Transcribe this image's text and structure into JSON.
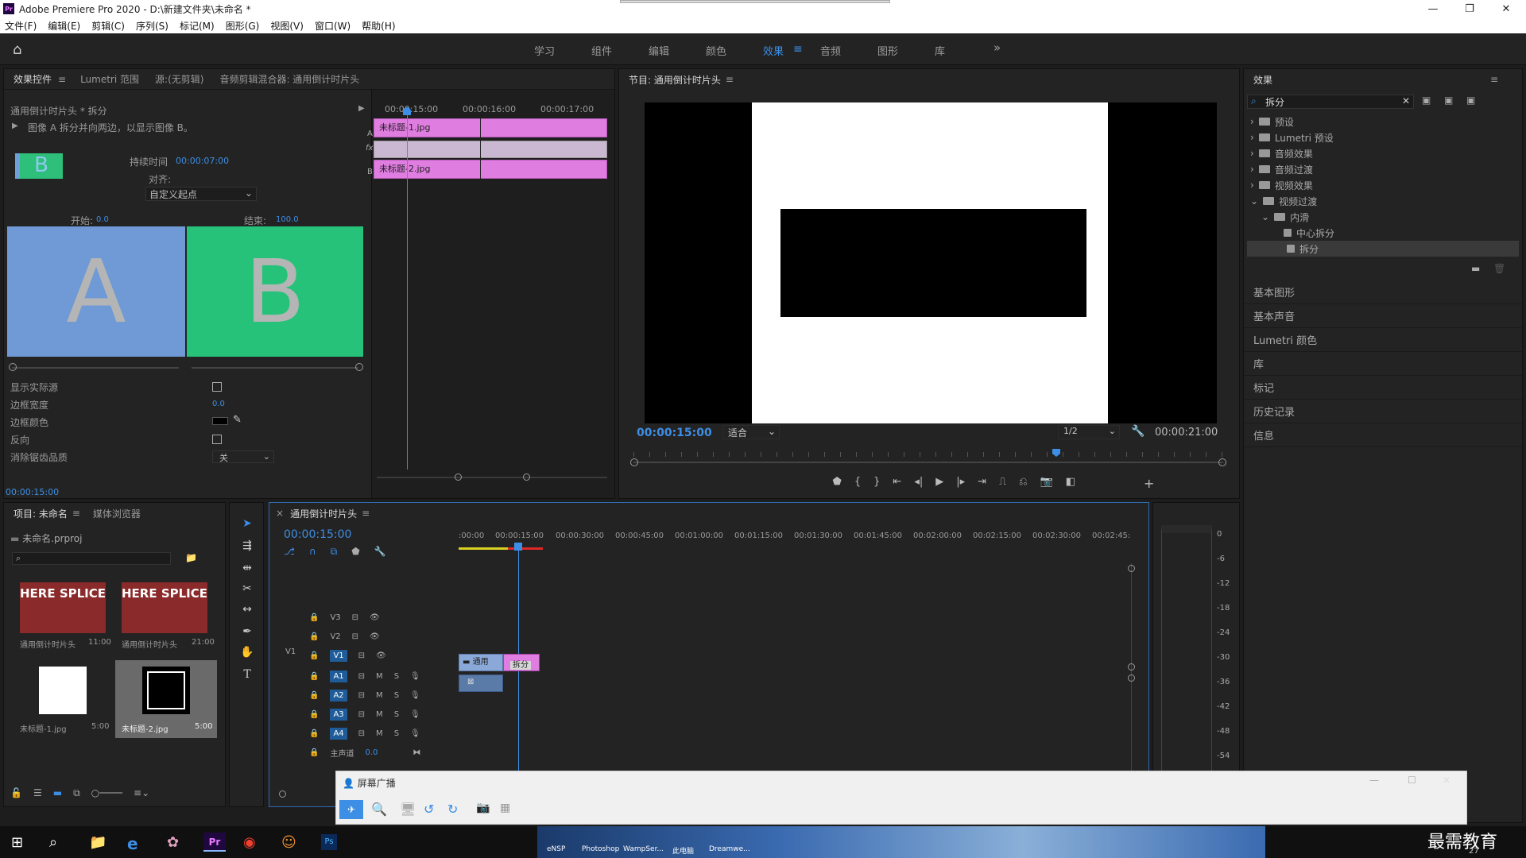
{
  "window": {
    "title": "Adobe Premiere Pro 2020 - D:\\新建文件夹\\未命名 *",
    "minimize": "—",
    "maximize": "❐",
    "close": "✕"
  },
  "menu": [
    "文件(F)",
    "编辑(E)",
    "剪辑(C)",
    "序列(S)",
    "标记(M)",
    "图形(G)",
    "视图(V)",
    "窗口(W)",
    "帮助(H)"
  ],
  "workspaces": {
    "tabs": [
      "学习",
      "组件",
      "编辑",
      "颜色",
      "效果",
      "音频",
      "图形",
      "库"
    ],
    "active": "效果",
    "more": "»"
  },
  "effect_controls": {
    "tabs": [
      "效果控件",
      "Lumetri 范围",
      "源:(无剪辑)",
      "音频剪辑混合器: 通用倒计时片头"
    ],
    "clip_path": "通用倒计时片头 * 拆分",
    "description": "图像 A 拆分并向两边，以显示图像 B。",
    "duration_label": "持续时间",
    "duration_value": "00:00:07:00",
    "align_label": "对齐:",
    "align_value": "自定义起点",
    "start_label": "开始:",
    "start_value": "0.0",
    "end_label": "结束:",
    "end_value": "100.0",
    "preview_a": "A",
    "preview_b": "B",
    "thumb_letter": "B",
    "props": [
      {
        "label": "显示实际源"
      },
      {
        "label": "边框宽度",
        "value": "0.0"
      },
      {
        "label": "边框颜色"
      },
      {
        "label": "反向"
      },
      {
        "label": "消除锯齿品质",
        "value": "关"
      }
    ],
    "timecode": "00:00:15:00",
    "ruler": [
      "00:00:15:00",
      "00:00:16:00",
      "00:00:17:00"
    ],
    "clip_a": "未标题-1.jpg",
    "clip_b": "未标题-2.jpg",
    "track_a": "A",
    "track_b": "B",
    "fx": "fx"
  },
  "program": {
    "title": "节目: 通用倒计时片头",
    "timecode": "00:00:15:00",
    "fit": "适合",
    "res": "1/2",
    "duration": "00:00:21:00"
  },
  "effects": {
    "title": "效果",
    "search": "拆分",
    "tree": [
      {
        "label": "预设"
      },
      {
        "label": "Lumetri 预设"
      },
      {
        "label": "音频效果"
      },
      {
        "label": "音频过渡"
      },
      {
        "label": "视频效果"
      },
      {
        "label": "视频过渡"
      },
      {
        "label": "内滑"
      },
      {
        "label": "中心拆分"
      },
      {
        "label": "拆分"
      }
    ],
    "sections": [
      "基本图形",
      "基本声音",
      "Lumetri 颜色",
      "库",
      "标记",
      "历史记录",
      "信息"
    ]
  },
  "project": {
    "tabs": [
      "项目: 未命名",
      "媒体浏览器"
    ],
    "file": "未命名.prproj",
    "items": [
      {
        "name": "通用倒计时片头",
        "dur": "11:00",
        "img": "HERE SPLICE"
      },
      {
        "name": "通用倒计时片头",
        "dur": "21:00",
        "img": "HERE SPLICE"
      },
      {
        "name": "未标题-1.jpg",
        "dur": "5:00"
      },
      {
        "name": "未标题-2.jpg",
        "dur": "5:00"
      }
    ]
  },
  "timeline": {
    "title": "通用倒计时片头",
    "timecode": "00:00:15:00",
    "ruler": [
      ":00:00",
      "00:00:15:00",
      "00:00:30:00",
      "00:00:45:00",
      "00:01:00:00",
      "00:01:15:00",
      "00:01:30:00",
      "00:01:45:00",
      "00:02:00:00",
      "00:02:15:00",
      "00:02:30:00",
      "00:02:45:"
    ],
    "video_tracks": [
      "V3",
      "V2",
      "V1"
    ],
    "audio_tracks": [
      "A1",
      "A2",
      "A3",
      "A4"
    ],
    "master": "主声道",
    "master_val": "0.0",
    "clip_v1": "通用",
    "transition": "拆分",
    "src_v1": "V1"
  },
  "meter": [
    "0",
    "-6",
    "-12",
    "-18",
    "-24",
    "-30",
    "-36",
    "-42",
    "-48",
    "-54"
  ],
  "broadcast": {
    "title": "屏幕广播"
  },
  "taskbar": {
    "apps": [
      "eNSP",
      "Photoshop",
      "WampSer...",
      "此电脑",
      "Dreamwe..."
    ],
    "watermark": "最需教育",
    "time": "27"
  },
  "colors": {
    "accent": "#3a8fe8",
    "clip": "#e07de0",
    "sel_track": "#1f5c99"
  }
}
